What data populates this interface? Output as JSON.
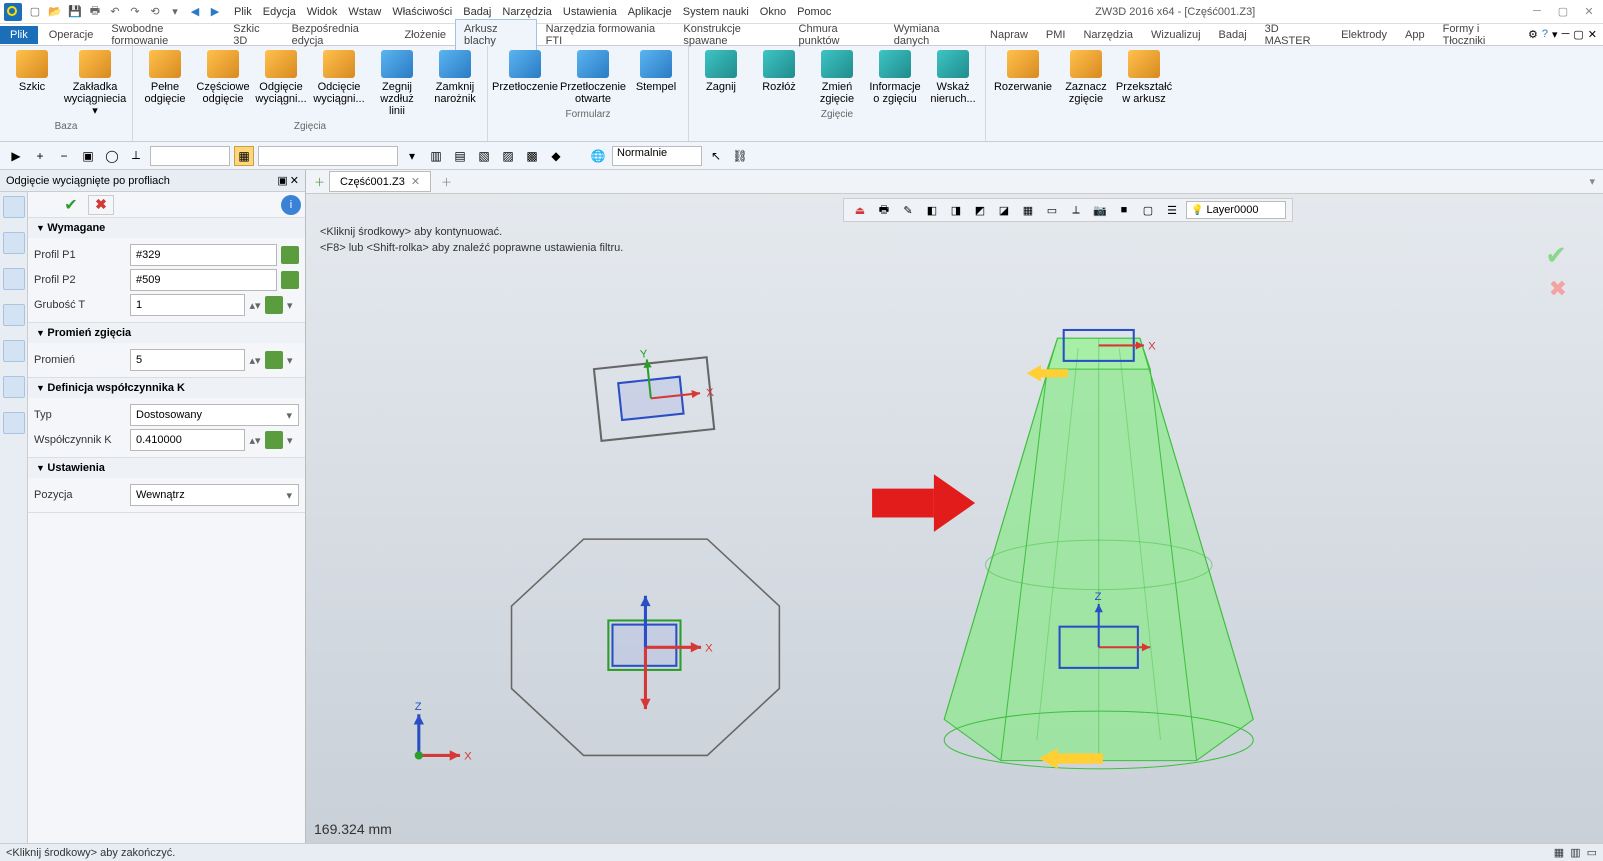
{
  "title": "ZW3D 2016  x64 - [Część001.Z3]",
  "menus": [
    "Plik",
    "Edycja",
    "Widok",
    "Wstaw",
    "Właściwości",
    "Badaj",
    "Narzędzia",
    "Ustawienia",
    "Aplikacje",
    "System nauki",
    "Okno",
    "Pomoc"
  ],
  "ribbon": {
    "file_tab": "Plik",
    "tabs": [
      "Operacje",
      "Swobodne formowanie",
      "Szkic 3D",
      "Bezpośrednia edycja",
      "Złożenie",
      "Arkusz blachy",
      "Narzędzia formowania FTI",
      "Konstrukcje spawane",
      "Chmura punktów",
      "Wymiana danych",
      "Napraw",
      "PMI",
      "Narzędzia",
      "Wizualizuj",
      "Badaj",
      "3D MASTER",
      "Elektrody",
      "App",
      "Formy i Tłoczniki"
    ],
    "active_tab_index": 5,
    "groups": {
      "baza": {
        "label": "Baza",
        "btns": [
          "Szkic",
          "Zakładka wyciągniecia ▾"
        ]
      },
      "zgiecia": {
        "label": "Zgięcia",
        "btns": [
          "Pełne odgięcie",
          "Częściowe odgięcie",
          "Odgięcie wyciągni...",
          "Odcięcie wyciągni...",
          "Zegnij wzdłuż linii",
          "Zamknij narożnik"
        ]
      },
      "formularz": {
        "label": "Formularz",
        "btns": [
          "Przetłoczenie",
          "Przetłoczenie otwarte",
          "Stempel"
        ]
      },
      "zgiecie": {
        "label": "Zgięcie",
        "btns": [
          "Zagnij",
          "Rozłóż",
          "Zmień zgięcie",
          "Informacje o zgięciu",
          "Wskaż nieruch..."
        ]
      },
      "misc": {
        "btns": [
          "Rozerwanie",
          "Zaznacz zgięcie",
          "Przekształć w arkusz"
        ]
      }
    }
  },
  "toolbar2": {
    "mode": "Normalnie"
  },
  "panel": {
    "title": "Odgięcie wyciągnięte po profliach",
    "sections": {
      "wymagane": {
        "label": "Wymagane",
        "profil_p1": {
          "label": "Profil P1",
          "value": "#329"
        },
        "profil_p2": {
          "label": "Profil P2",
          "value": "#509"
        },
        "grubosc": {
          "label": "Grubość T",
          "value": "1"
        }
      },
      "promien": {
        "label": "Promień zgięcia",
        "promien": {
          "label": "Promień",
          "value": "5"
        }
      },
      "kfactor": {
        "label": "Definicja współczynnika K",
        "typ": {
          "label": "Typ",
          "value": "Dostosowany"
        },
        "wsp": {
          "label": "Współczynnik K",
          "value": "0.410000"
        }
      },
      "ustawienia": {
        "label": "Ustawienia",
        "pozycja": {
          "label": "Pozycja",
          "value": "Wewnątrz"
        }
      }
    }
  },
  "doc_tab": "Część001.Z3",
  "hint_line1": "<Kliknij środkowy> aby kontynuować.",
  "hint_line2": "<F8> lub <Shift-rolka> aby znaleźć poprawne ustawienia filtru.",
  "layer": "Layer0000",
  "mm": "169.324 mm",
  "status": "<Kliknij środkowy> aby zakończyć."
}
